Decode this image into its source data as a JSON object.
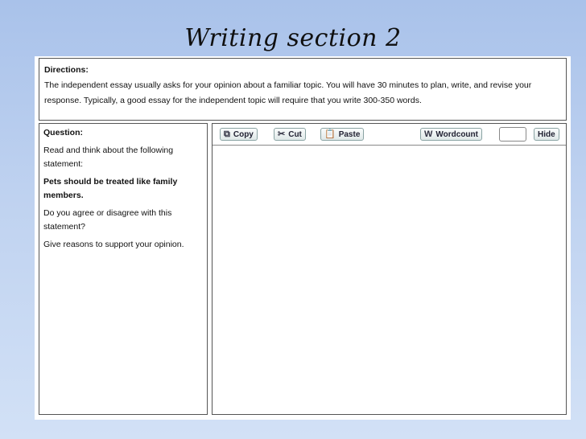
{
  "slide": {
    "title": "Writing section 2"
  },
  "directions": {
    "label": "Directions:",
    "text": "The independent essay usually asks for your opinion about a familiar topic. You will have 30 minutes to plan, write, and revise your response. Typically, a good essay for the independent topic will require that you write 300-350 words."
  },
  "question": {
    "label": "Question:",
    "intro": "Read and think about the following statement:",
    "statement": "Pets should be treated like family members.",
    "prompt": "Do you agree or disagree with this statement?",
    "instruction": "Give reasons to support your opinion."
  },
  "toolbar": {
    "copy_label": "Copy",
    "cut_label": "Cut",
    "paste_label": "Paste",
    "wordcount_label": "Wordcount",
    "wordcount_value": "",
    "hide_label": "Hide"
  },
  "editor": {
    "value": ""
  },
  "icons": {
    "copy": "copy-icon",
    "cut": "scissors-icon",
    "paste": "clipboard-icon",
    "wordcount": "wordcount-icon"
  }
}
